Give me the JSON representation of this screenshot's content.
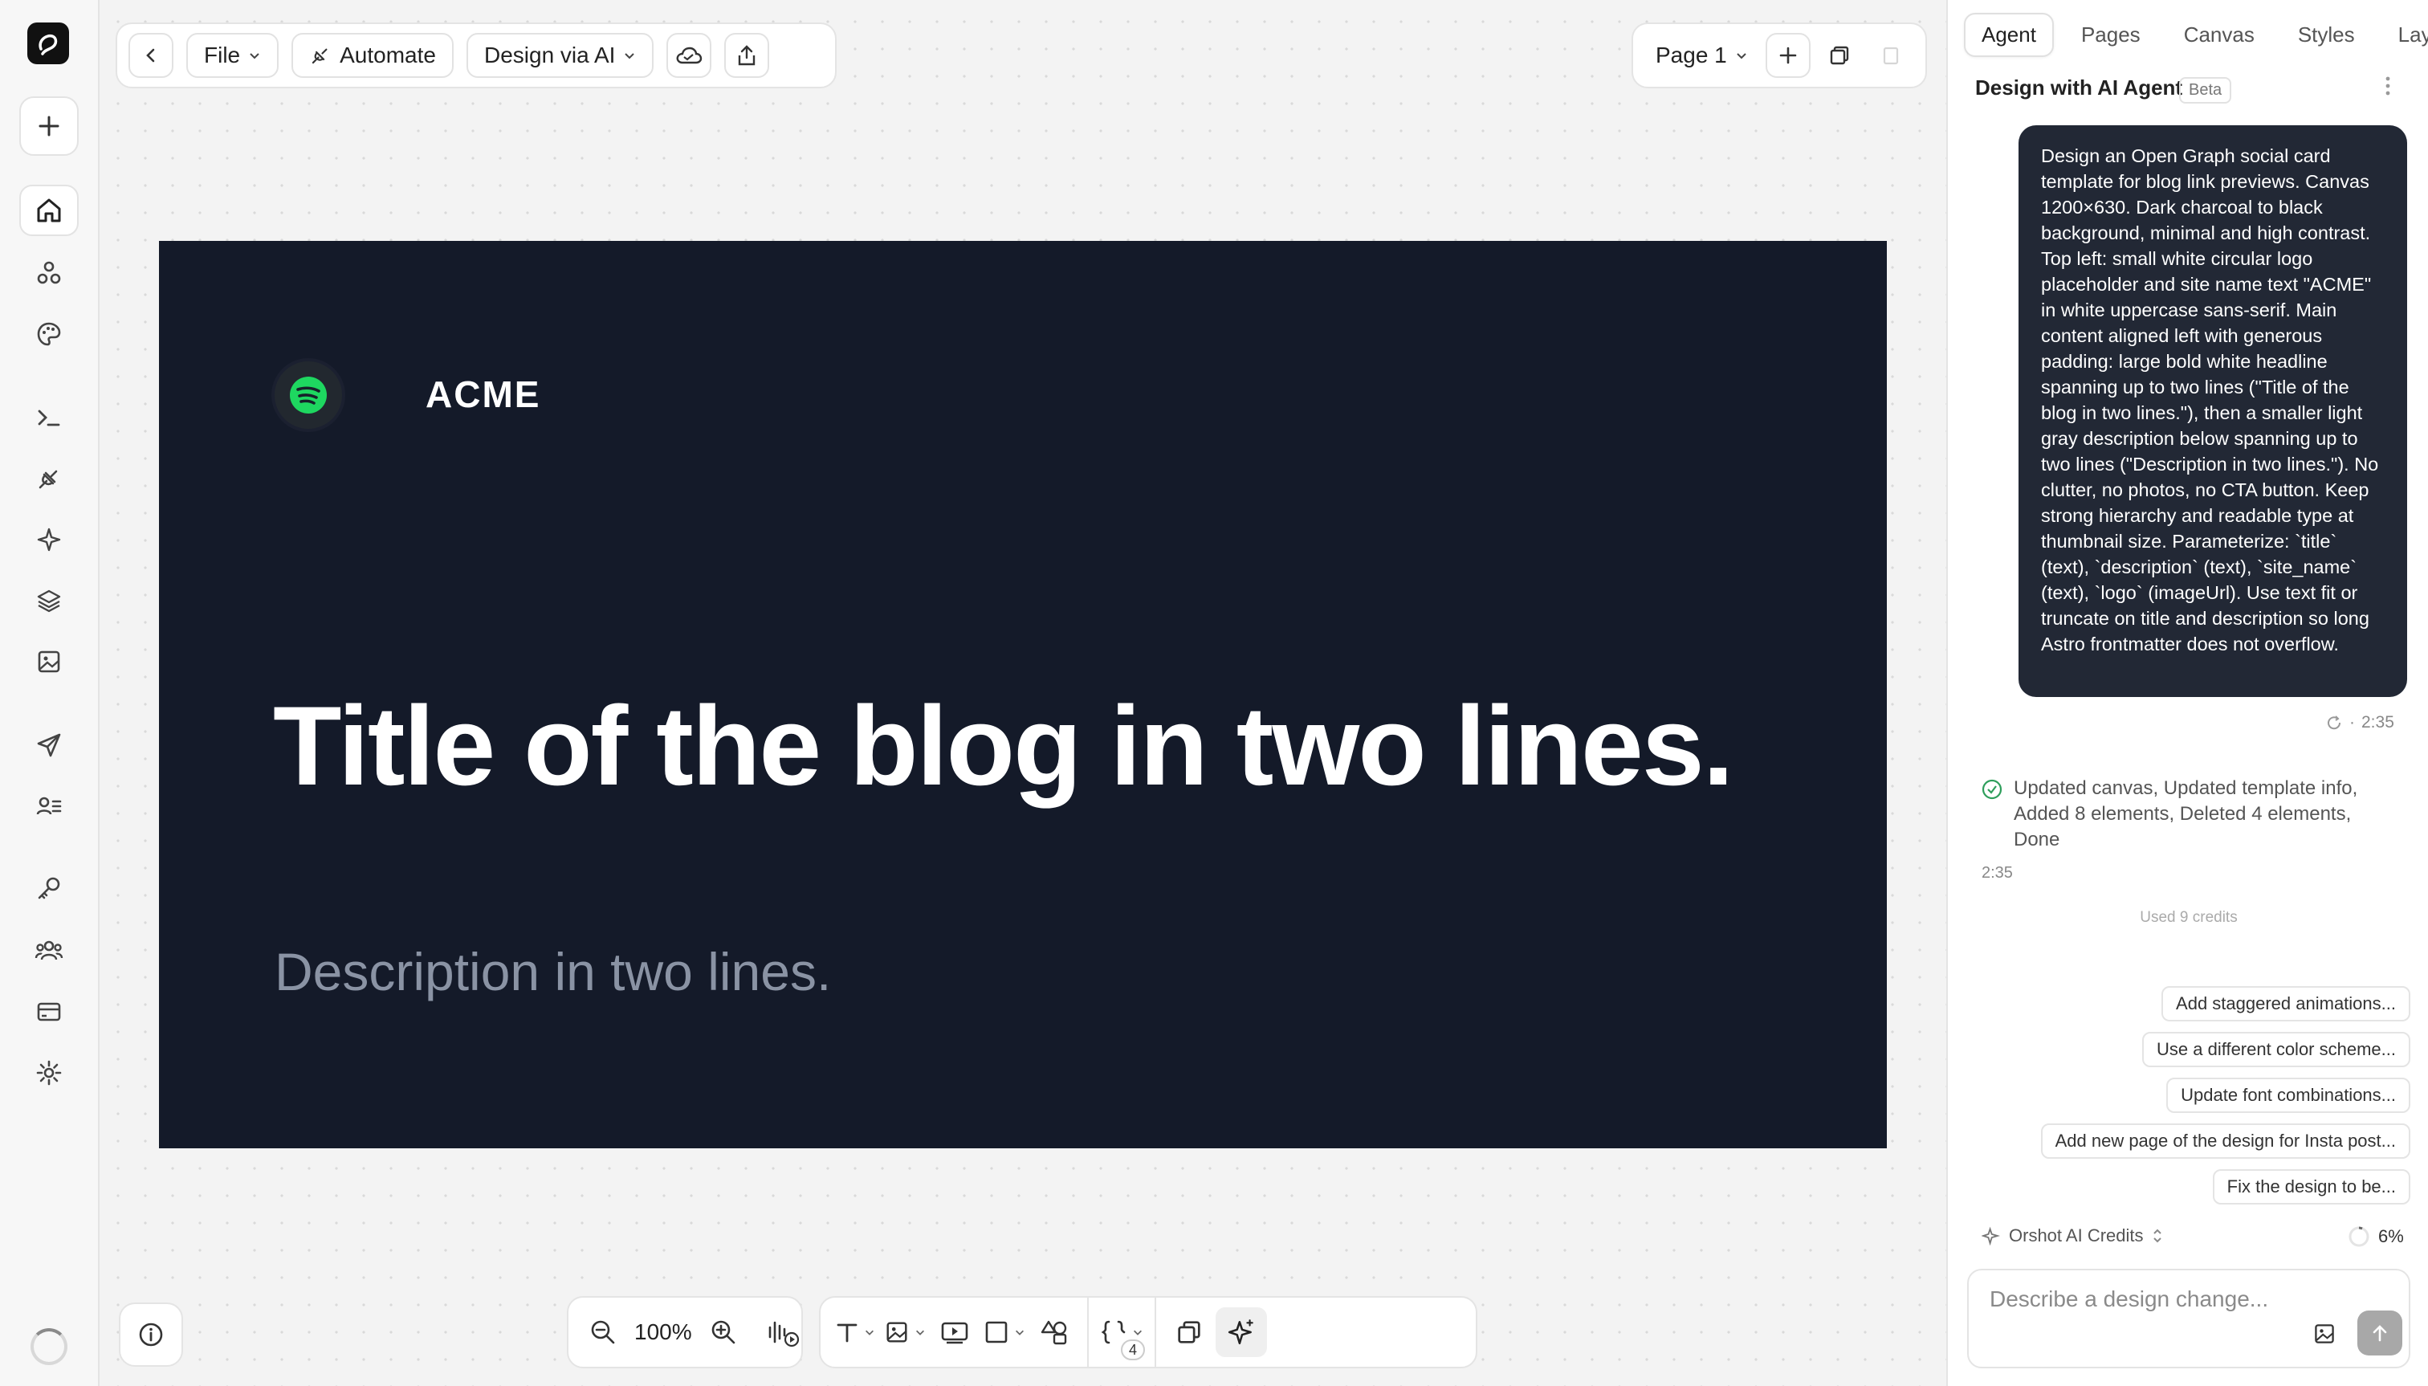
{
  "toolbar": {
    "file": "File",
    "automate": "Automate",
    "design_via_ai": "Design via AI",
    "page": "Page 1"
  },
  "artboard": {
    "site_name": "ACME",
    "title": "Title of the blog in two lines.",
    "description": "Description in two lines."
  },
  "bottom_toolbar": {
    "zoom": "100%",
    "variables_count": "4"
  },
  "panel": {
    "tabs": [
      "Agent",
      "Pages",
      "Canvas",
      "Styles",
      "Layers"
    ],
    "title": "Design with AI Agent",
    "beta": "Beta",
    "prompt": "Design an Open Graph social card template for blog link previews. Canvas 1200×630. Dark charcoal to black background, minimal and high contrast. Top left: small white circular logo placeholder and site name text \"ACME\" in white uppercase sans-serif. Main content aligned left with generous padding: large bold white headline spanning up to two lines (\"Title of the blog in two lines.\"), then a smaller light gray description below spanning up to two lines (\"Description in two lines.\"). No clutter, no photos, no CTA button. Keep strong hierarchy and readable type at thumbnail size. Parameterize: `title` (text), `description` (text), `site_name` (text), `logo` (imageUrl). Use text fit or truncate on title and description so long Astro frontmatter does not overflow.",
    "prompt_time": "2:35",
    "meta_sep": "·",
    "status": "Updated canvas, Updated template info, Added 8 elements, Deleted 4 elements, Done",
    "status_time": "2:35",
    "credits_used": "Used 9 credits",
    "suggestions": [
      "Add staggered animations...",
      "Use a different color scheme...",
      "Update font combinations...",
      "Add new page of the design for Insta post...",
      "Fix the design to be..."
    ],
    "ai_credits_label": "Orshot AI Credits",
    "ai_credits_percent": "6%",
    "input_placeholder": "Describe a design change..."
  },
  "colors": {
    "artboard_bg": "#141a29",
    "description_text": "#8a93a4",
    "bubble_bg": "#222835",
    "status_green": "#2e9e5b"
  }
}
